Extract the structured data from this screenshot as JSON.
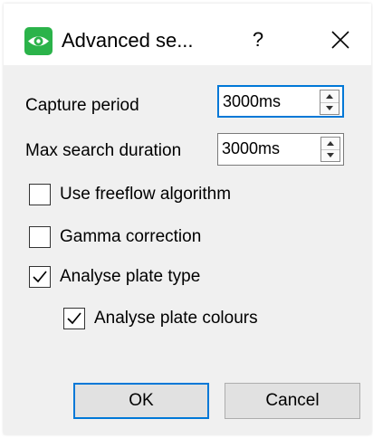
{
  "dialog": {
    "title": "Advanced se...",
    "help_label": "?",
    "close_label": "×"
  },
  "fields": [
    {
      "label": "Capture period",
      "value": "3000ms"
    },
    {
      "label": "Max search duration",
      "value": "3000ms"
    }
  ],
  "checkboxes": [
    {
      "label": "Use freeflow algorithm",
      "checked": false
    },
    {
      "label": "Gamma correction",
      "checked": false
    },
    {
      "label": "Analyse plate type",
      "checked": true
    },
    {
      "label": "Analyse plate colours",
      "checked": true
    }
  ],
  "buttons": {
    "ok": "OK",
    "cancel": "Cancel"
  },
  "colors": {
    "accent": "#0078d7",
    "icon_green": "#2bb34a",
    "dialog_bg": "#f0f0f0"
  },
  "icons": {
    "app": "eye-icon",
    "close": "close-icon",
    "spin_up": "chevron-up-icon",
    "spin_down": "chevron-down-icon",
    "check": "checkmark-icon"
  }
}
